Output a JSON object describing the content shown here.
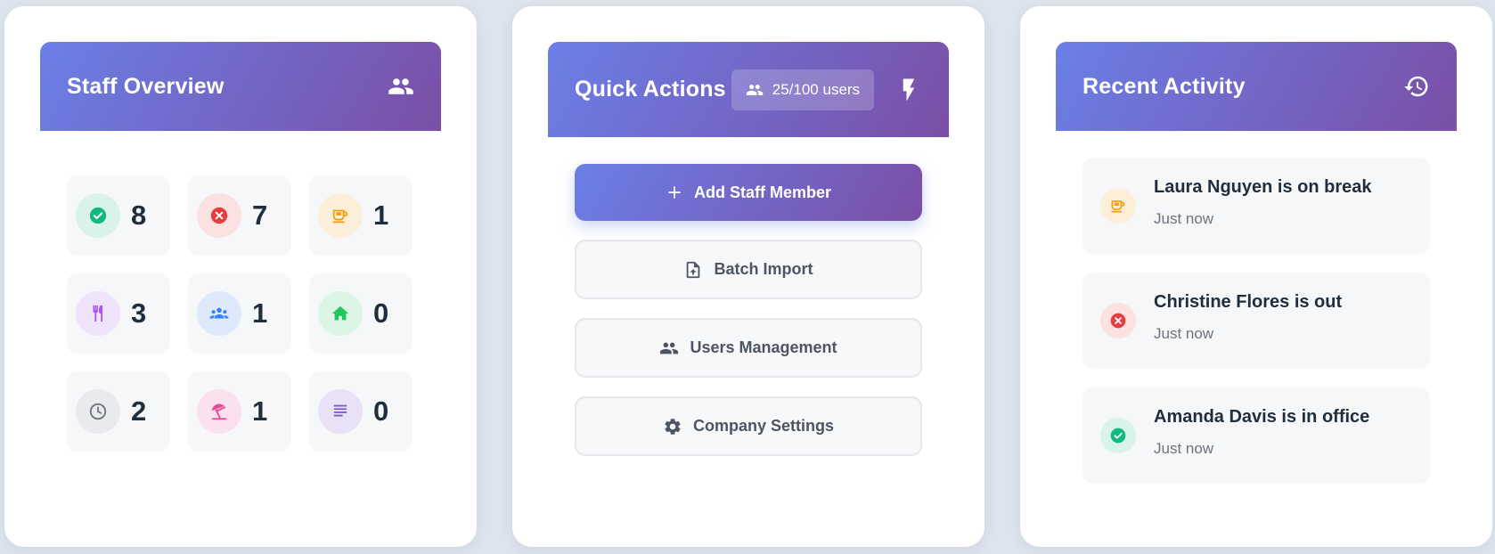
{
  "staff_overview": {
    "title": "Staff Overview",
    "header_icon": "users-icon",
    "stats": [
      {
        "key": "in-office",
        "icon": "check-circle-icon",
        "value": "8",
        "color": "#10b981",
        "bg": "#d9f3ea"
      },
      {
        "key": "out",
        "icon": "x-circle-icon",
        "value": "7",
        "color": "#e53e3e",
        "bg": "#fbe1e1"
      },
      {
        "key": "break",
        "icon": "coffee-icon",
        "value": "1",
        "color": "#f59e0b",
        "bg": "#fcefd9"
      },
      {
        "key": "lunch",
        "icon": "utensils-icon",
        "value": "3",
        "color": "#a855f7",
        "bg": "#efe3fb"
      },
      {
        "key": "meeting",
        "icon": "group-icon",
        "value": "1",
        "color": "#3b82f6",
        "bg": "#dde8fb"
      },
      {
        "key": "home",
        "icon": "home-icon",
        "value": "0",
        "color": "#22c55e",
        "bg": "#dcf5e4"
      },
      {
        "key": "pending",
        "icon": "clock-icon",
        "value": "2",
        "color": "#6b7280",
        "bg": "#e9eaed"
      },
      {
        "key": "vacation",
        "icon": "umbrella-icon",
        "value": "1",
        "color": "#ec4899",
        "bg": "#fbe0ee"
      },
      {
        "key": "other",
        "icon": "notes-icon",
        "value": "0",
        "color": "#7c5cc4",
        "bg": "#e9e1f6"
      }
    ]
  },
  "quick_actions": {
    "title": "Quick Actions",
    "users_badge": "25/100 users",
    "header_icon": "lightning-icon",
    "buttons": [
      {
        "label": "Add Staff Member",
        "icon": "plus-icon"
      },
      {
        "label": "Batch Import",
        "icon": "file-upload-icon"
      },
      {
        "label": "Users Management",
        "icon": "users-icon"
      },
      {
        "label": "Company Settings",
        "icon": "gear-icon"
      }
    ]
  },
  "recent_activity": {
    "title": "Recent Activity",
    "header_icon": "history-icon",
    "items": [
      {
        "text": "Laura Nguyen is on break",
        "time": "Just now",
        "icon": "coffee-icon",
        "color": "#f59e0b",
        "bg": "#fcefd9"
      },
      {
        "text": "Christine Flores is out",
        "time": "Just now",
        "icon": "x-circle-icon",
        "color": "#e53e3e",
        "bg": "#fbe1e1"
      },
      {
        "text": "Amanda Davis is in office",
        "time": "Just now",
        "icon": "check-circle-icon",
        "color": "#10b981",
        "bg": "#d9f3ea"
      }
    ]
  }
}
